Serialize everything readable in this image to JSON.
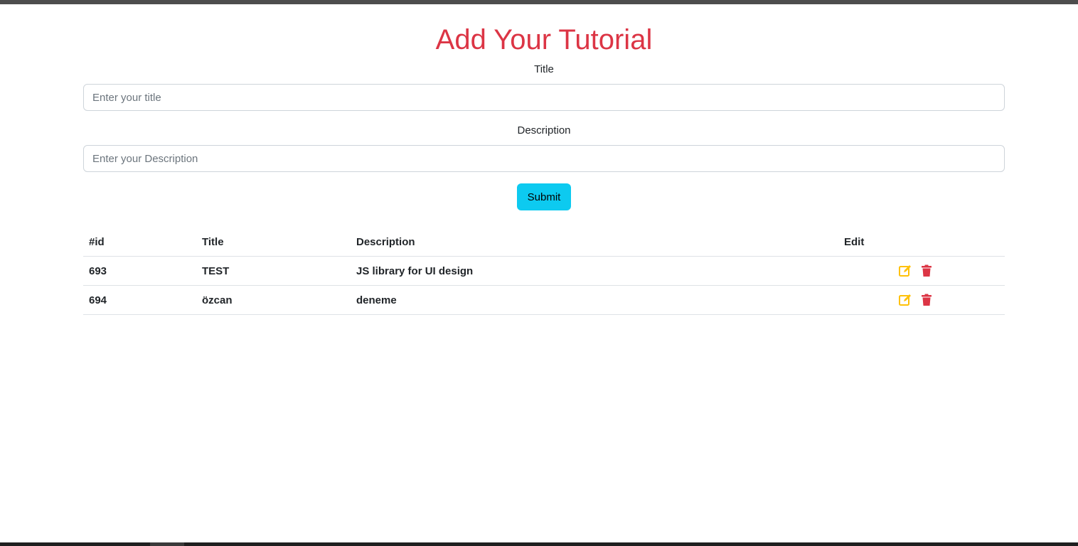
{
  "header": {
    "title": "Add Your Tutorial"
  },
  "form": {
    "title_label": "Title",
    "title_placeholder": "Enter your title",
    "title_value": "",
    "description_label": "Description",
    "description_placeholder": "Enter your Description",
    "description_value": "",
    "submit_label": "Submit"
  },
  "table": {
    "headers": [
      "#id",
      "Title",
      "Description",
      "Edit"
    ],
    "rows": [
      {
        "id": "693",
        "title": "TEST",
        "description": "JS library for UI design"
      },
      {
        "id": "694",
        "title": "özcan",
        "description": "deneme"
      }
    ],
    "edit_icon": "edit-icon",
    "delete_icon": "trash-icon"
  },
  "colors": {
    "title": "#dc3545",
    "submit_bg": "#0dcaf0",
    "edit_icon": "#ffc107",
    "delete_icon": "#dc3545"
  }
}
